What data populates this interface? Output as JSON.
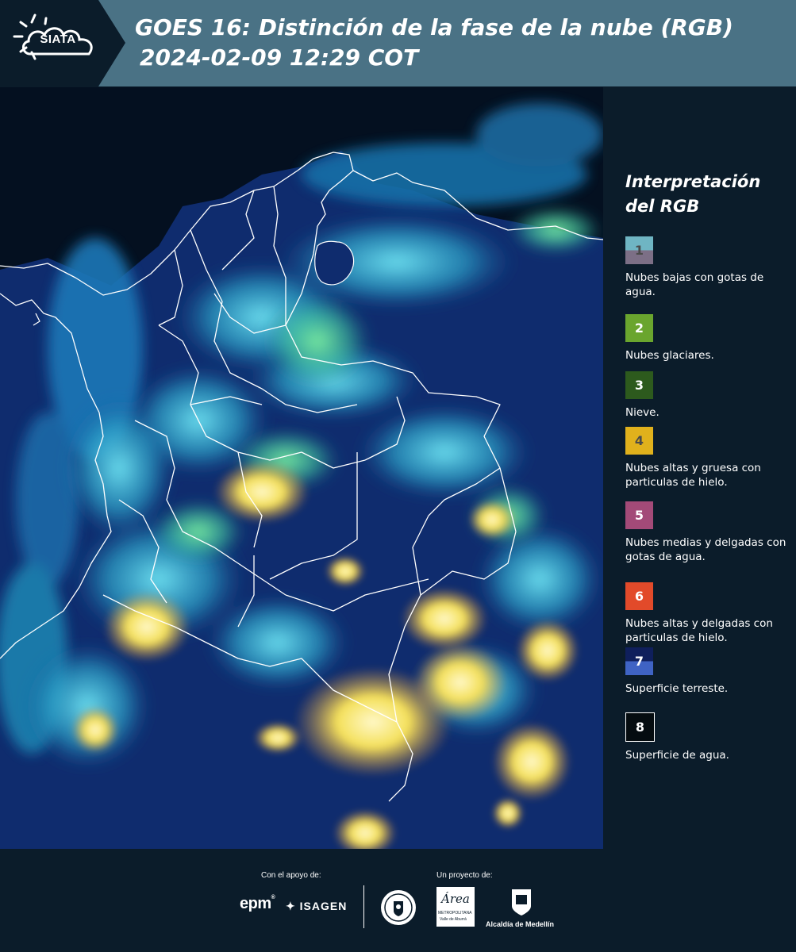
{
  "header": {
    "logo_text": "SIATA",
    "title": "GOES 16: Distinción de la fase de la nube (RGB)",
    "subtitle": "2024-02-09 12:29 COT"
  },
  "legend": {
    "title": "Interpretación del RGB",
    "items": [
      {
        "num": "1",
        "label": "Nubes bajas con gotas de agua.",
        "top_color": "#6fb5c3",
        "bottom_color": "#7c6f86",
        "text_color": "#4a4a4a"
      },
      {
        "num": "2",
        "label": "Nubes glaciares.",
        "top_color": "#6aa52e",
        "bottom_color": "#6aa52e",
        "text_color": "#ffffff"
      },
      {
        "num": "3",
        "label": "Nieve.",
        "top_color": "#2d5a1d",
        "bottom_color": "#2d5a1d",
        "text_color": "#ffffff"
      },
      {
        "num": "4",
        "label": "Nubes altas y gruesa con particulas de hielo.",
        "top_color": "#e0b11c",
        "bottom_color": "#e0b11c",
        "text_color": "#4a4a4a"
      },
      {
        "num": "5",
        "label": "Nubes medias y delgadas con gotas de agua.",
        "top_color": "#a34a78",
        "bottom_color": "#a34a78",
        "text_color": "#ffffff"
      },
      {
        "num": "6",
        "label": "Nubes altas y delgadas con particulas de hielo.",
        "top_color": "#e24a2a",
        "bottom_color": "#e24a2a",
        "text_color": "#ffffff"
      },
      {
        "num": "7",
        "label": "Superficie terreste.",
        "top_color": "#0f1f5c",
        "bottom_color": "#3f63c4",
        "text_color": "#ffffff"
      },
      {
        "num": "8",
        "label": "Superficie de agua.",
        "top_color": "#050c10",
        "bottom_color": "#050c10",
        "text_color": "#ffffff"
      }
    ]
  },
  "footer": {
    "support_label": "Con el apoyo de:",
    "project_label": "Un proyecto de:",
    "sponsor_epm": "epm",
    "sponsor_isagen": "ISAGEN",
    "area_label": "Área",
    "area_sub": "METROPOLITANA",
    "area_sub2": "Valle de Aburrá",
    "alcaldia": "Alcaldía de Medellín"
  },
  "colors": {
    "header_bg": "#4a7285",
    "page_bg": "#0b1c2a",
    "ocean": "#041020"
  }
}
